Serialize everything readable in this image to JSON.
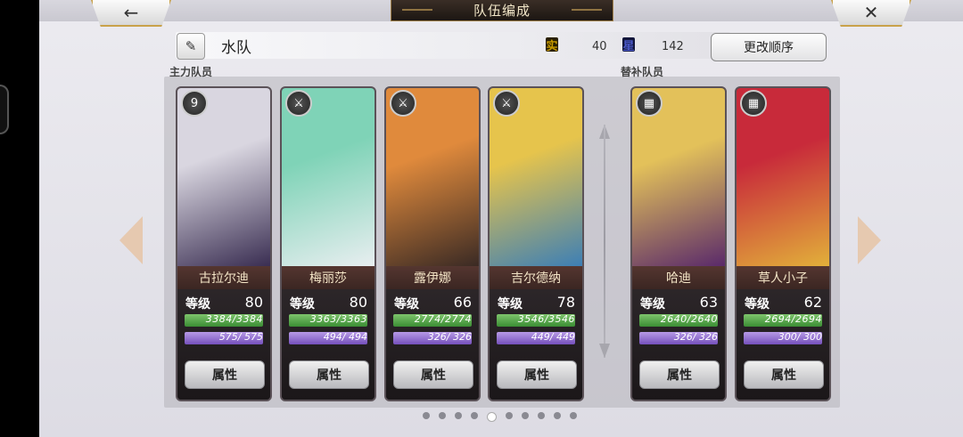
{
  "header": {
    "title": "队伍编成",
    "back_icon": "←",
    "close_icon": "✕"
  },
  "team": {
    "name": "水队",
    "edit_icon": "✎",
    "stat1_icon": "实",
    "stat1_value": "40",
    "stat2_icon": "星",
    "stat2_value": "142",
    "order_button": "更改顺序"
  },
  "sections": {
    "main": "主力队员",
    "sub": "替补队员"
  },
  "level_label": "等级",
  "attr_label": "属性",
  "members": [
    {
      "name": "古拉尔迪",
      "level": "80",
      "hp": "3384/3384",
      "mp": "575/ 575",
      "weapon": "9",
      "c1": "#d9d6e0",
      "c2": "#3a2e52"
    },
    {
      "name": "梅丽莎",
      "level": "80",
      "hp": "3363/3363",
      "mp": "494/ 494",
      "weapon": "⚔",
      "c1": "#7fd3b7",
      "c2": "#e8eef0"
    },
    {
      "name": "露伊娜",
      "level": "66",
      "hp": "2774/2774",
      "mp": "326/ 326",
      "weapon": "⚔",
      "c1": "#e08a3c",
      "c2": "#3a2a24"
    },
    {
      "name": "吉尔德纳",
      "level": "78",
      "hp": "3546/3546",
      "mp": "449/ 449",
      "weapon": "⚔",
      "c1": "#e6c44c",
      "c2": "#3d7fb5"
    },
    {
      "name": "哈迪",
      "level": "63",
      "hp": "2640/2640",
      "mp": "326/ 326",
      "weapon": "▦",
      "c1": "#e3c15a",
      "c2": "#5a2a6a"
    },
    {
      "name": "草人小子",
      "level": "62",
      "hp": "2694/2694",
      "mp": "300/ 300",
      "weapon": "▦",
      "c1": "#c82a3a",
      "c2": "#e2b03a"
    }
  ],
  "pagination": {
    "count": 10,
    "active": 4
  }
}
